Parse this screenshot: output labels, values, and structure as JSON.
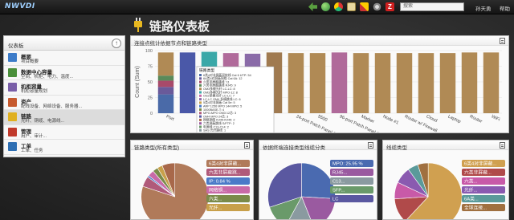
{
  "app": {
    "logo": "NWVDI",
    "title": "链路仪表板"
  },
  "topbar": {
    "search_placeholder": "搜索",
    "user": "孙天勇",
    "user_menu": "帮助",
    "icons": [
      "back-arrow-icon",
      "globe-icon",
      "chrome-icon",
      "clipboard-icon",
      "tools-icon",
      "gear-icon",
      "z-app-icon"
    ]
  },
  "sidebar": {
    "title": "仪表板",
    "collapse_glyph": "↑",
    "items": [
      {
        "label": "概要",
        "sub": "项目概要",
        "icon": "document-icon",
        "color": "#3d7cc9"
      },
      {
        "label": "数据中心容量",
        "sub": "空间、机柜、电力、温度...",
        "icon": "datacenter-icon",
        "color": "#4a8f3a"
      },
      {
        "label": "机柜容量",
        "sub": "机柜容量规划",
        "icon": "rack-icon",
        "color": "#7a5fa8"
      },
      {
        "label": "资产",
        "sub": "配线设备、网络设备、服务器...",
        "icon": "asset-icon",
        "color": "#c65a2e"
      },
      {
        "label": "链路",
        "sub": "光纤、铜缆、电源线...",
        "icon": "link-plug-icon",
        "color": "#e0b020",
        "active": true
      },
      {
        "label": "管理",
        "sub": "用户、审计...",
        "icon": "admin-icon",
        "color": "#c0392b"
      },
      {
        "label": "工单",
        "sub": "工单、任务",
        "icon": "workorder-icon",
        "color": "#2e6fb3"
      }
    ]
  },
  "main_chart": {
    "title": "连接点统计依据节点和链路类型",
    "ylabel": "Count (Sum)",
    "tooltip_title": "链路类型",
    "tooltip_items": [
      "6类4对非屏蔽双绞线 Cat 6 UTP: 54",
      "6A类4对屏蔽铜缆 Cat 6A: 12",
      "六类非屏蔽跳线: 11",
      "六类非屏蔽跳线 RJ45: 9",
      "OM3多模光纤 LC-LC: 8",
      "OM3多模光纤 MPO-12: 8",
      "OS2单模光纤 LC-LC: 7",
      "LC-LC OM4 多模跳线 LC: 6",
      "5类4对非屏蔽 Cat 5e: 5",
      "ARP 1256 MPO 144 MPO: 5",
      "1000BASE-T: 4",
      "MPO-MPO OM3 12芯: 3",
      "OM4 MPO 24芯: 3",
      "网络铜缆 RJ45-RJ45: 2",
      "六类屏蔽跳线 S/FTP: 2",
      "电源线 C13-C14: 2",
      "SAS 光纤跳线: 1",
      "其他: 1"
    ]
  },
  "chart_data": [
    {
      "type": "bar",
      "title": "连接点统计依据节点和链路类型",
      "xlabel": "",
      "ylabel": "Count (Sum)",
      "ylim": [
        0,
        100
      ],
      "grid": true,
      "categories": [
        "Port",
        "",
        "",
        "",
        "",
        "",
        "24-port Patch Panel (LC)",
        "5500",
        "96-port Patch Panel (LC)",
        "Marker",
        "Node #1",
        "Router w/ Firewall",
        "Cloud",
        "Laptop",
        "Router",
        "WiFi"
      ],
      "values": [
        97,
        97,
        98,
        96,
        95,
        97,
        96,
        96,
        97,
        96,
        96,
        96,
        96,
        96,
        97,
        97
      ],
      "colors": [
        "#b08a55",
        "#4a58a8",
        "#3aa8a8",
        "#b06a9a",
        "#8a6ba8",
        "#a07a50",
        "#b08a55",
        "#b08a55",
        "#b06a9a",
        "#b08a55",
        "#b08a55",
        "#b08a55",
        "#b08a55",
        "#b08a55",
        "#b08a55",
        "#b08a55"
      ],
      "stacked_first_bar": [
        {
          "color": "#4a6aa8",
          "value": 30
        },
        {
          "color": "#6a5a9a",
          "value": 12
        },
        {
          "color": "#a84a6a",
          "value": 10
        },
        {
          "color": "#5a8a5a",
          "value": 8
        },
        {
          "color": "#b08a55",
          "value": 37
        }
      ]
    },
    {
      "type": "pie",
      "title": "链路类型(所有类型)",
      "slices": [
        {
          "label": "6类4对非屏蔽...",
          "value": 80.0,
          "color": "#b07a5a"
        },
        {
          "label": "六类非屏蔽跳...",
          "value": 5.0,
          "color": "#b05a7a"
        },
        {
          "label": "IP: 0.84 %",
          "value": 0.84,
          "color": "#4a7ac8"
        },
        {
          "label": "网络铜...",
          "value": 3.0,
          "color": "#c86aa8"
        },
        {
          "label": "六类...",
          "value": 2.5,
          "color": "#7a8a4a"
        },
        {
          "label": "光纤...",
          "value": 2.5,
          "color": "#c8a04a"
        },
        {
          "label": "全球连接...",
          "value": 6.16,
          "color": "#a8684a"
        }
      ]
    },
    {
      "type": "pie",
      "title": "依据终端连接类型线缆分类",
      "slices": [
        {
          "label": "MPO: 25.95 %",
          "value": 25.95,
          "color": "#4a6ab0"
        },
        {
          "label": "RJ45...",
          "value": 18.0,
          "color": "#9a5aa0"
        },
        {
          "label": "C13...",
          "value": 14.0,
          "color": "#8a9aa0"
        },
        {
          "label": "SFP...",
          "value": 12.0,
          "color": "#6a9a6a"
        },
        {
          "label": "LC",
          "value": 30.05,
          "color": "#5a58a0"
        }
      ]
    },
    {
      "type": "pie",
      "title": "线缆类型",
      "slices": [
        {
          "label": "6类4对非屏蔽...",
          "value": 62.0,
          "color": "#d0a050"
        },
        {
          "label": "六类非屏蔽...",
          "value": 12.0,
          "color": "#b04a4a"
        },
        {
          "label": "六类...",
          "value": 8.0,
          "color": "#c85aa8"
        },
        {
          "label": "光纤...",
          "value": 8.0,
          "color": "#8a5ab0"
        },
        {
          "label": "6A类...",
          "value": 5.0,
          "color": "#5a9a9a"
        },
        {
          "label": "全球连接...",
          "value": 5.0,
          "color": "#a07040"
        }
      ]
    }
  ],
  "panels": {
    "bar": {
      "title": "连接点统计依据节点和链路类型"
    },
    "pie1": {
      "title": "链路类型(所有类型)"
    },
    "pie2": {
      "title": "依据终端连接类型线缆分类"
    },
    "pie3": {
      "title": "线缆类型"
    }
  }
}
